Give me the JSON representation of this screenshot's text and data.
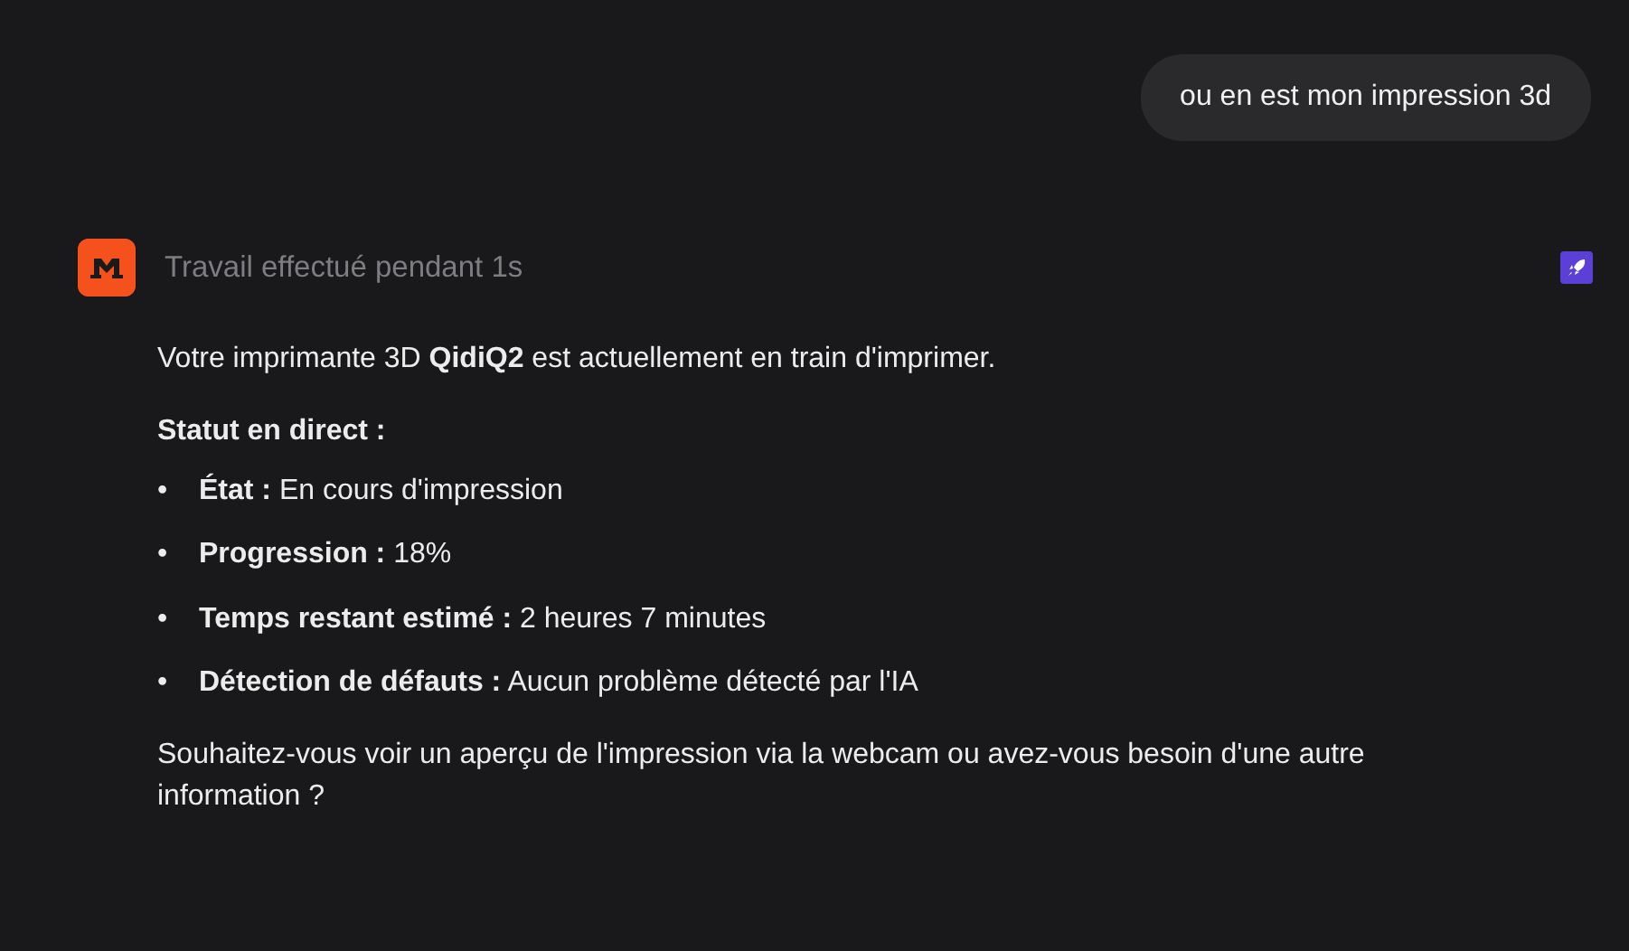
{
  "user_message": "ou en est mon impression 3d",
  "assistant": {
    "status": "Travail effectué pendant 1s",
    "intro": "Votre imprimante 3D **QidiQ2** est actuellement en train d'imprimer.",
    "heading": "Statut en direct :",
    "items": [
      {
        "marker": "•",
        "text": "**État :** En cours d'impression"
      },
      {
        "marker": "•",
        "text": "**Progression :** 18%"
      },
      {
        "marker": "•",
        "text": "**Temps restant estimé :** 2 heures 7 minutes"
      },
      {
        "marker": "•",
        "text": "**Détection de défauts :** Aucun problème détecté par l'IA"
      }
    ],
    "closing": "Souhaitez-vous voir un aperçu de l'impression via la webcam ou avez-vous besoin d'une autre information ?"
  }
}
